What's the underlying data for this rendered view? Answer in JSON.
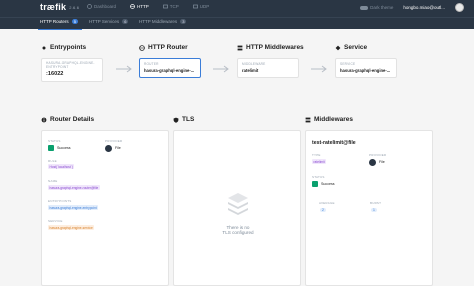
{
  "nav": {
    "logo": "træfik",
    "version": "2.6.6",
    "items": [
      {
        "label": "Dashboard",
        "active": false
      },
      {
        "label": "HTTP",
        "active": true
      },
      {
        "label": "TCP",
        "active": false
      },
      {
        "label": "UDP",
        "active": false
      }
    ],
    "theme_label": "Dark theme",
    "user_label": "hongbo.miao@outl..."
  },
  "subtabs": [
    {
      "label": "HTTP Routers",
      "count": "5"
    },
    {
      "label": "HTTP Services",
      "count": "6"
    },
    {
      "label": "HTTP Middlewares",
      "count": "3"
    }
  ],
  "flow": {
    "entrypoints": {
      "title": "Entrypoints",
      "label": "HASURA-GRAPHQL-ENGINE-ENTRYPOINT",
      "value": ":16022"
    },
    "router": {
      "title": "HTTP Router",
      "label": "ROUTER",
      "value": "hasura-graphql-engine-..."
    },
    "middlewares": {
      "title": "HTTP Middlewares",
      "label": "MIDDLEWARE",
      "value": "ratelimit"
    },
    "service": {
      "title": "Service",
      "label": "SERVICE",
      "value": "hasura-graphql-engine-..."
    }
  },
  "router_details": {
    "title": "Router Details",
    "status_label": "STATUS",
    "status_value": "Success",
    "provider_label": "PROVIDER",
    "provider_value": "File",
    "rule_label": "RULE",
    "rule_value": "Host(`localhost`)",
    "name_label": "NAME",
    "name_value": "hasura-graphql-engine-router@file",
    "entrypoints_label": "ENTRYPOINTS",
    "entrypoints_value": "hasura-graphql-engine-entrypoint",
    "service_label": "SERVICE",
    "service_value": "hasura-graphql-engine-service"
  },
  "tls": {
    "title": "TLS",
    "empty_line1": "There is no",
    "empty_line2": "TLS configured"
  },
  "middlewares": {
    "title": "Middlewares",
    "name": "test-ratelimit@file",
    "type_label": "TYPE",
    "type_value": "ratelimit",
    "provider_label": "PROVIDER",
    "provider_value": "File",
    "status_label": "STATUS",
    "status_value": "Success",
    "average_label": "AVERAGE",
    "average_value": "2",
    "burst_label": "BURST",
    "burst_value": "1"
  },
  "colors": {
    "nav_bg": "#2a3644",
    "accent": "#3b7dd8",
    "success": "#0aa06e"
  }
}
